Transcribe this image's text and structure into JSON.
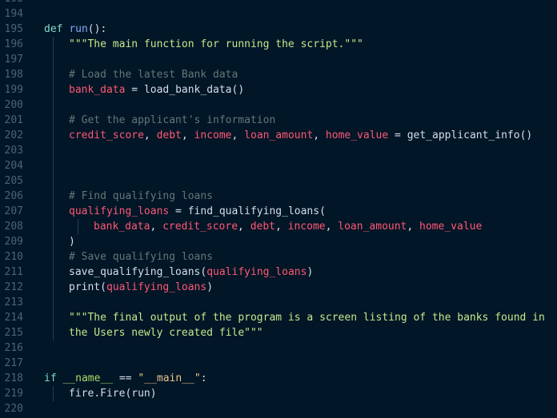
{
  "editor": {
    "language": "python",
    "theme_colors": {
      "background": "#011627",
      "line_number": "#4b6479",
      "keyword": "#7fdbca",
      "string": "#ecc48d",
      "comment": "#637777",
      "variable": "#ff5874"
    },
    "lines": [
      {
        "n": "193",
        "indent": 0,
        "guides": [],
        "tokens": []
      },
      {
        "n": "194",
        "indent": 0,
        "guides": [],
        "tokens": []
      },
      {
        "n": "195",
        "indent": 0,
        "guides": [],
        "tokens": [
          {
            "t": "def",
            "c": "keyword"
          },
          {
            "t": " ",
            "c": "plain"
          },
          {
            "t": "run",
            "c": "defname"
          },
          {
            "t": "():",
            "c": "punct"
          }
        ]
      },
      {
        "n": "196",
        "indent": 4,
        "guides": [
          1
        ],
        "tokens": [
          {
            "t": "\"\"\"The main function for running the script.\"\"\"",
            "c": "docstring"
          }
        ]
      },
      {
        "n": "197",
        "indent": 0,
        "guides": [
          1
        ],
        "tokens": []
      },
      {
        "n": "198",
        "indent": 4,
        "guides": [
          1
        ],
        "tokens": [
          {
            "t": "# Load the latest Bank data",
            "c": "comment"
          }
        ]
      },
      {
        "n": "199",
        "indent": 4,
        "guides": [
          1
        ],
        "tokens": [
          {
            "t": "bank_data",
            "c": "var"
          },
          {
            "t": " = ",
            "c": "op"
          },
          {
            "t": "load_bank_data",
            "c": "func"
          },
          {
            "t": "()",
            "c": "punct"
          }
        ]
      },
      {
        "n": "200",
        "indent": 0,
        "guides": [
          1
        ],
        "tokens": []
      },
      {
        "n": "201",
        "indent": 4,
        "guides": [
          1
        ],
        "tokens": [
          {
            "t": "# Get the applicant's information",
            "c": "comment"
          }
        ]
      },
      {
        "n": "202",
        "indent": 4,
        "guides": [
          1
        ],
        "tokens": [
          {
            "t": "credit_score",
            "c": "var"
          },
          {
            "t": ", ",
            "c": "punct"
          },
          {
            "t": "debt",
            "c": "var"
          },
          {
            "t": ", ",
            "c": "punct"
          },
          {
            "t": "income",
            "c": "var"
          },
          {
            "t": ", ",
            "c": "punct"
          },
          {
            "t": "loan_amount",
            "c": "var"
          },
          {
            "t": ", ",
            "c": "punct"
          },
          {
            "t": "home_value",
            "c": "var"
          },
          {
            "t": " = ",
            "c": "op"
          },
          {
            "t": "get_applicant_info",
            "c": "func"
          },
          {
            "t": "()",
            "c": "punct"
          }
        ]
      },
      {
        "n": "203",
        "indent": 0,
        "guides": [
          1
        ],
        "tokens": []
      },
      {
        "n": "204",
        "indent": 0,
        "guides": [
          1
        ],
        "tokens": []
      },
      {
        "n": "205",
        "indent": 0,
        "guides": [
          1
        ],
        "tokens": []
      },
      {
        "n": "206",
        "indent": 4,
        "guides": [
          1
        ],
        "tokens": [
          {
            "t": "# Find qualifying loans",
            "c": "comment"
          }
        ]
      },
      {
        "n": "207",
        "indent": 4,
        "guides": [
          1
        ],
        "tokens": [
          {
            "t": "qualifying_loans",
            "c": "var"
          },
          {
            "t": " = ",
            "c": "op"
          },
          {
            "t": "find_qualifying_loans",
            "c": "func"
          },
          {
            "t": "(",
            "c": "punct"
          }
        ]
      },
      {
        "n": "208",
        "indent": 8,
        "guides": [
          1,
          2
        ],
        "tokens": [
          {
            "t": "bank_data",
            "c": "var"
          },
          {
            "t": ", ",
            "c": "punct"
          },
          {
            "t": "credit_score",
            "c": "var"
          },
          {
            "t": ", ",
            "c": "punct"
          },
          {
            "t": "debt",
            "c": "var"
          },
          {
            "t": ", ",
            "c": "punct"
          },
          {
            "t": "income",
            "c": "var"
          },
          {
            "t": ", ",
            "c": "punct"
          },
          {
            "t": "loan_amount",
            "c": "var"
          },
          {
            "t": ", ",
            "c": "punct"
          },
          {
            "t": "home_value",
            "c": "var"
          }
        ]
      },
      {
        "n": "209",
        "indent": 4,
        "guides": [
          1
        ],
        "tokens": [
          {
            "t": ")",
            "c": "punct"
          }
        ]
      },
      {
        "n": "210",
        "indent": 4,
        "guides": [
          1
        ],
        "tokens": [
          {
            "t": "# Save qualifying loans",
            "c": "comment"
          }
        ]
      },
      {
        "n": "211",
        "indent": 4,
        "guides": [
          1
        ],
        "tokens": [
          {
            "t": "save_qualifying_loans",
            "c": "func"
          },
          {
            "t": "(",
            "c": "punct"
          },
          {
            "t": "qualifying_loans",
            "c": "var"
          },
          {
            "t": ")",
            "c": "punct"
          }
        ]
      },
      {
        "n": "212",
        "indent": 4,
        "guides": [
          1
        ],
        "tokens": [
          {
            "t": "print",
            "c": "func"
          },
          {
            "t": "(",
            "c": "punct"
          },
          {
            "t": "qualifying_loans",
            "c": "var"
          },
          {
            "t": ")",
            "c": "punct"
          }
        ]
      },
      {
        "n": "213",
        "indent": 0,
        "guides": [
          1
        ],
        "tokens": []
      },
      {
        "n": "214",
        "indent": 4,
        "guides": [
          1
        ],
        "tokens": [
          {
            "t": "\"\"\"The final output of the program is a screen listing of the banks found in",
            "c": "docstring"
          }
        ]
      },
      {
        "n": "215",
        "indent": 4,
        "guides": [
          1
        ],
        "tokens": [
          {
            "t": "the Users newly created file\"\"\"",
            "c": "docstring"
          }
        ]
      },
      {
        "n": "216",
        "indent": 0,
        "guides": [],
        "tokens": []
      },
      {
        "n": "217",
        "indent": 0,
        "guides": [],
        "tokens": []
      },
      {
        "n": "218",
        "indent": 0,
        "guides": [],
        "tokens": [
          {
            "t": "if",
            "c": "keyword"
          },
          {
            "t": " ",
            "c": "plain"
          },
          {
            "t": "__name__",
            "c": "dunder"
          },
          {
            "t": " == ",
            "c": "op"
          },
          {
            "t": "\"__main__\"",
            "c": "string"
          },
          {
            "t": ":",
            "c": "punct"
          }
        ]
      },
      {
        "n": "219",
        "indent": 4,
        "guides": [
          1
        ],
        "tokens": [
          {
            "t": "fire",
            "c": "ident"
          },
          {
            "t": ".",
            "c": "punct"
          },
          {
            "t": "Fire",
            "c": "func"
          },
          {
            "t": "(",
            "c": "punct"
          },
          {
            "t": "run",
            "c": "ident"
          },
          {
            "t": ")",
            "c": "punct"
          }
        ]
      },
      {
        "n": "220",
        "indent": 0,
        "guides": [],
        "tokens": []
      }
    ]
  }
}
